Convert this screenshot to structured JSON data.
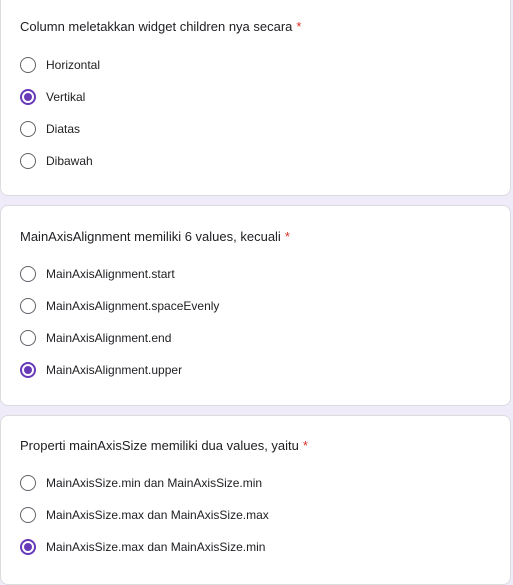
{
  "accent_color": "#673ab7",
  "required_marker": "*",
  "questions": [
    {
      "text": "Column meletakkan widget children nya secara",
      "options": [
        {
          "label": "Horizontal",
          "selected": false
        },
        {
          "label": "Vertikal",
          "selected": true
        },
        {
          "label": "Diatas",
          "selected": false
        },
        {
          "label": "Dibawah",
          "selected": false
        }
      ]
    },
    {
      "text": "MainAxisAlignment memiliki 6 values, kecuali",
      "options": [
        {
          "label": "MainAxisAlignment.start",
          "selected": false
        },
        {
          "label": "MainAxisAlignment.spaceEvenly",
          "selected": false
        },
        {
          "label": "MainAxisAlignment.end",
          "selected": false
        },
        {
          "label": "MainAxisAlignment.upper",
          "selected": true
        }
      ]
    },
    {
      "text": "Properti mainAxisSize memiliki dua values, yaitu",
      "options": [
        {
          "label": "MainAxisSize.min dan MainAxisSize.min",
          "selected": false
        },
        {
          "label": "MainAxisSize.max dan MainAxisSize.max",
          "selected": false
        },
        {
          "label": "MainAxisSize.max dan MainAxisSize.min",
          "selected": true
        }
      ]
    }
  ]
}
